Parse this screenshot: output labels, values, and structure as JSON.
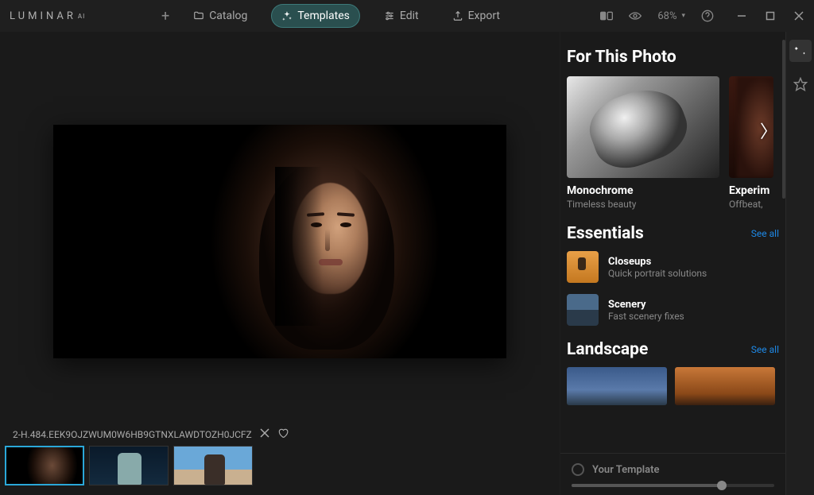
{
  "app": {
    "logo_main": "LUMINAR",
    "logo_sup": "AI"
  },
  "nav": {
    "catalog": "Catalog",
    "templates": "Templates",
    "edit": "Edit",
    "export": "Export"
  },
  "zoom": {
    "value": "68%"
  },
  "file": {
    "name": "2-H.484.EEK9OJZWUM0W6HB9GTNXLAWDTOZH0JCFZ"
  },
  "panel": {
    "for_this_photo": "For This Photo",
    "cards": [
      {
        "title": "Monochrome",
        "sub": "Timeless beauty"
      },
      {
        "title": "Experim",
        "sub": "Offbeat,"
      }
    ],
    "essentials": {
      "title": "Essentials",
      "see_all": "See all",
      "items": [
        {
          "title": "Closeups",
          "sub": "Quick portrait solutions"
        },
        {
          "title": "Scenery",
          "sub": "Fast scenery fixes"
        }
      ]
    },
    "landscape": {
      "title": "Landscape",
      "see_all": "See all"
    },
    "your_template": "Your Template"
  }
}
